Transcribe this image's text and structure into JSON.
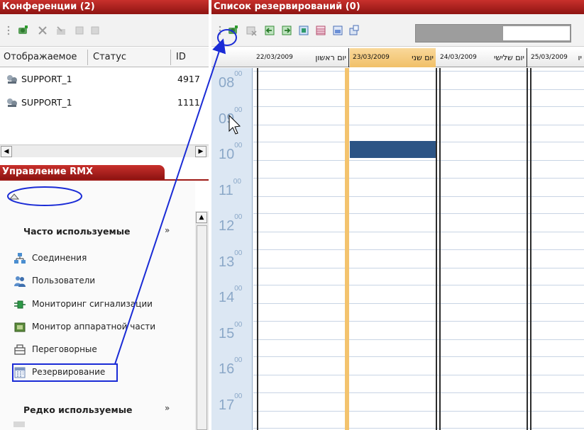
{
  "conferences": {
    "title": "Конференции (2)",
    "columns": [
      "Отображаемое",
      "Статус",
      "ID"
    ],
    "rows": [
      {
        "name": "SUPPORT_1",
        "id": "4917"
      },
      {
        "name": "SUPPORT_1",
        "id": "1111"
      }
    ]
  },
  "rmx": {
    "title": "Управление RMX",
    "frequent_title": "Часто используемые",
    "rare_title": "Редко используемые",
    "items": [
      {
        "label": "Соединения",
        "icon": "connections-icon"
      },
      {
        "label": "Пользователи",
        "icon": "users-icon"
      },
      {
        "label": "Мониторинг сигнализации",
        "icon": "signaling-monitor-icon"
      },
      {
        "label": "Монитор аппаратной части",
        "icon": "hardware-monitor-icon"
      },
      {
        "label": "Переговорные",
        "icon": "meeting-rooms-icon"
      },
      {
        "label": "Резервирование",
        "icon": "reservation-icon"
      }
    ]
  },
  "reservations": {
    "title": "Список резервирований (0)",
    "days": [
      {
        "date": "22/03/2009",
        "weekday": "יום ראשון"
      },
      {
        "date": "23/03/2009",
        "weekday": "יום שני"
      },
      {
        "date": "24/03/2009",
        "weekday": "יום שלישי"
      },
      {
        "date": "25/03/2009",
        "weekday": "יו"
      }
    ],
    "hours": [
      "08",
      "09",
      "10",
      "11",
      "12",
      "13",
      "14",
      "15",
      "16",
      "17"
    ],
    "minutes": "00"
  },
  "colors": {
    "titlebar": "#b4201c",
    "time_column": "#dce7f3",
    "booking": "#2c5485",
    "today": "#f3c36e",
    "annotation": "#1a2bd6"
  }
}
